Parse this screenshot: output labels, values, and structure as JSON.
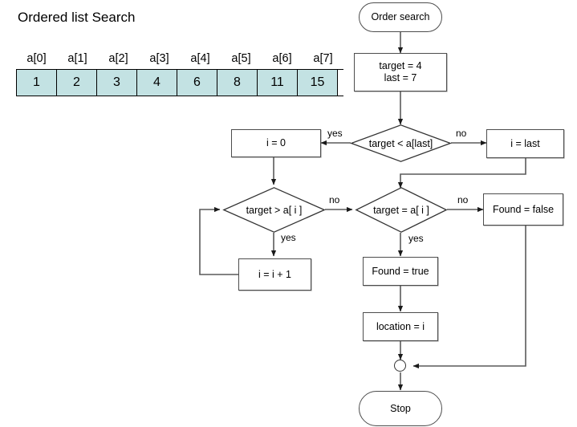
{
  "page": {
    "title": "Ordered list Search",
    "background": "#ffffff",
    "line_color": "#4d4d4d",
    "text_color": "#000000"
  },
  "array": {
    "cell_fill": "#c3e2e3",
    "labels": [
      "a[0]",
      "a[1]",
      "a[2]",
      "a[3]",
      "a[4]",
      "a[5]",
      "a[6]",
      "a[7]"
    ],
    "values": [
      "1",
      "2",
      "3",
      "4",
      "6",
      "8",
      "11",
      "15"
    ]
  },
  "flowchart": {
    "nodes": {
      "start": "Order search",
      "init": "target = 4\nlast = 7",
      "init_line1": "target = 4",
      "init_line2": "last = 7",
      "decision_last": "target < a[last]",
      "set_i_zero": "i = 0",
      "set_i_last": "i = last",
      "decision_greater": "target > a[ i ]",
      "decision_equal": "target = a[ i ]",
      "increment": "i = i + 1",
      "found_true": "Found = true",
      "found_false": "Found = false",
      "location": "location = i",
      "stop": "Stop"
    },
    "edge_labels": {
      "last_yes": "yes",
      "last_no": "no",
      "greater_no": "no",
      "greater_yes": "yes",
      "equal_no": "no",
      "equal_yes": "yes"
    }
  }
}
